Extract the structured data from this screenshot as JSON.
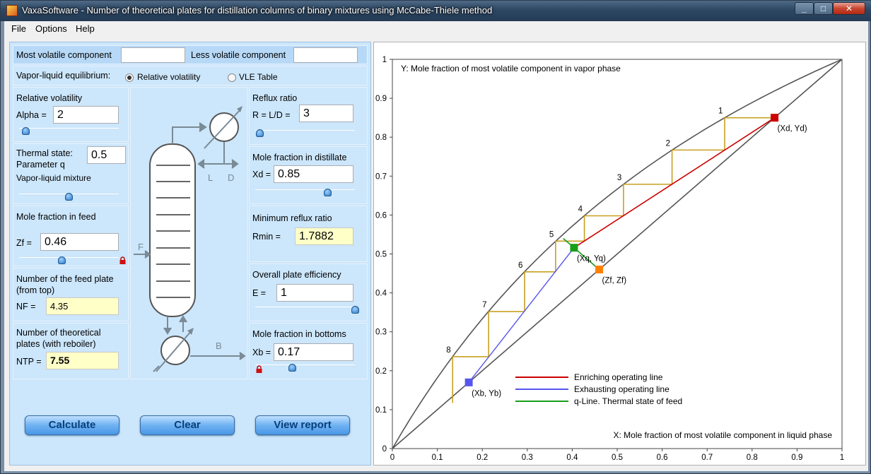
{
  "window": {
    "title": "VaxaSoftware - Number of theoretical plates for distillation columns of binary mixtures using McCabe-Thiele method",
    "min_icon": "minimize-icon",
    "max_icon": "maximize-icon",
    "close_icon": "close-icon"
  },
  "menu": {
    "file": "File",
    "options": "Options",
    "help": "Help"
  },
  "components": {
    "most_label": "Most volatile component",
    "most_value": "",
    "less_label": "Less volatile component",
    "less_value": ""
  },
  "vle": {
    "label": "Vapor-liquid equilibrium:",
    "opt_relative": "Relative volatility",
    "opt_table": "VLE Table",
    "selected": "Relative volatility"
  },
  "relvol": {
    "title": "Relative volatility",
    "label": "Alpha =",
    "value": "2"
  },
  "thermal": {
    "title1": "Thermal state:",
    "title2": "Parameter q",
    "value": "0.5",
    "state": "Vapor-liquid mixture"
  },
  "feed": {
    "title": "Mole fraction in feed",
    "label": "Zf =",
    "value": "0.46"
  },
  "feedplate": {
    "title1": "Number of the feed plate",
    "title2": "(from top)",
    "label": "NF =",
    "value": "4.35"
  },
  "ntp": {
    "title1": "Number of theoretical",
    "title2": "plates (with reboiler)",
    "label": "NTP =",
    "value": "7.55"
  },
  "reflux": {
    "title": "Reflux ratio",
    "label": "R = L/D =",
    "value": "3"
  },
  "distillate": {
    "title": "Mole fraction in distillate",
    "label": "Xd =",
    "value": "0.85"
  },
  "rmin": {
    "title": "Minimum reflux ratio",
    "label": "Rmin =",
    "value": "1.7882"
  },
  "efficiency": {
    "title": "Overall plate efficiency",
    "label": "E =",
    "value": "1"
  },
  "bottoms": {
    "title": "Mole fraction in bottoms",
    "label": "Xb =",
    "value": "0.17"
  },
  "column_labels": {
    "F": "F",
    "L": "L",
    "D": "D",
    "B": "B"
  },
  "buttons": {
    "calculate": "Calculate",
    "clear": "Clear",
    "report": "View report"
  },
  "colors": {
    "enriching": "#cc0000",
    "exhausting": "#5555ee",
    "qline": "#1a9e1a",
    "steps": "#c8a020",
    "curve": "#555555"
  },
  "chart_data": {
    "type": "line",
    "ylabel": "Y: Mole fraction of most volatile component in vapor phase",
    "xlabel": "X: Mole fraction of most volatile component in liquid phase",
    "xlim": [
      0,
      1
    ],
    "ylim": [
      0,
      1
    ],
    "x_ticks": [
      "0",
      "0.1",
      "0.2",
      "0.3",
      "0.4",
      "0.5",
      "0.6",
      "0.7",
      "0.8",
      "0.9",
      "1"
    ],
    "y_ticks": [
      "0",
      "0.1",
      "0.2",
      "0.3",
      "0.4",
      "0.5",
      "0.6",
      "0.7",
      "0.8",
      "0.9",
      "1"
    ],
    "alpha": 2,
    "legend": [
      {
        "name": "Enriching operating line",
        "color": "#cc0000"
      },
      {
        "name": "Exhausting operating line",
        "color": "#5555ee"
      },
      {
        "name": "q-Line. Thermal state of feed",
        "color": "#1a9e1a"
      }
    ],
    "points": [
      {
        "label": "(Xd, Yd)",
        "x": 0.85,
        "y": 0.85,
        "color": "#cc0000"
      },
      {
        "label": "(Xq, Yq)",
        "x": 0.404,
        "y": 0.516,
        "color": "#1a9e1a"
      },
      {
        "label": "(Zf, Zf)",
        "x": 0.46,
        "y": 0.46,
        "color": "#ff8000"
      },
      {
        "label": "(Xb, Yb)",
        "x": 0.17,
        "y": 0.17,
        "color": "#5555ee"
      }
    ],
    "enriching_line": [
      [
        0.404,
        0.516
      ],
      [
        0.85,
        0.85
      ]
    ],
    "exhausting_line": [
      [
        0.17,
        0.17
      ],
      [
        0.404,
        0.516
      ]
    ],
    "q_line": [
      [
        0.38,
        0.54
      ],
      [
        0.46,
        0.46
      ]
    ],
    "steps": [
      {
        "n": "1",
        "x_eq": 0.739,
        "y": 0.85,
        "x_next": 0.739,
        "y_next": 0.767
      },
      {
        "n": "2",
        "x_eq": 0.622,
        "y": 0.767,
        "x_next": 0.622,
        "y_next": 0.679
      },
      {
        "n": "3",
        "x_eq": 0.514,
        "y": 0.679,
        "x_next": 0.514,
        "y_next": 0.598
      },
      {
        "n": "4",
        "x_eq": 0.427,
        "y": 0.598,
        "x_next": 0.427,
        "y_next": 0.533
      },
      {
        "n": "5",
        "x_eq": 0.363,
        "y": 0.533,
        "x_next": 0.363,
        "y_next": 0.454
      },
      {
        "n": "6",
        "x_eq": 0.294,
        "y": 0.454,
        "x_next": 0.294,
        "y_next": 0.352
      },
      {
        "n": "7",
        "x_eq": 0.214,
        "y": 0.352,
        "x_next": 0.214,
        "y_next": 0.236
      },
      {
        "n": "8",
        "x_eq": 0.134,
        "y": 0.236,
        "x_next": 0.134,
        "y_next": 0.117
      }
    ]
  }
}
